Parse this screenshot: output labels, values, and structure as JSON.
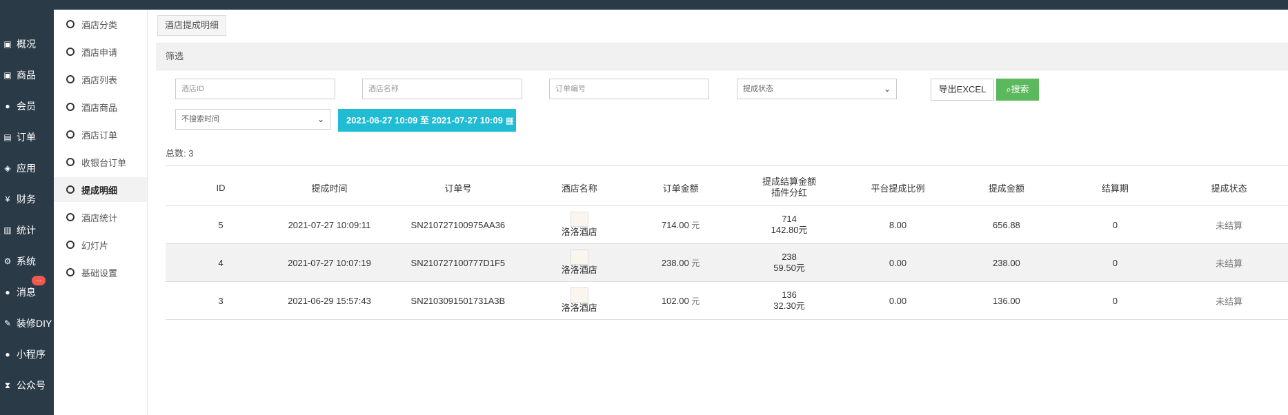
{
  "left_nav": [
    {
      "icon": "dashboard-icon",
      "label": "概况"
    },
    {
      "icon": "box-icon",
      "label": "商品"
    },
    {
      "icon": "users-icon",
      "label": "会员"
    },
    {
      "icon": "cart-icon",
      "label": "订单"
    },
    {
      "icon": "cubes-icon",
      "label": "应用"
    },
    {
      "icon": "yen-icon",
      "label": "财务"
    },
    {
      "icon": "bar-chart-icon",
      "label": "统计"
    },
    {
      "icon": "cogs-icon",
      "label": "系统"
    },
    {
      "icon": "chat-icon",
      "label": "消息"
    },
    {
      "icon": "wrench-icon",
      "label": "装修DIY"
    },
    {
      "icon": "wechat-icon",
      "label": "小程序"
    },
    {
      "icon": "hourglass-icon",
      "label": "公众号"
    }
  ],
  "badge": "...",
  "sub_nav": [
    {
      "label": "酒店分类"
    },
    {
      "label": "酒店申请"
    },
    {
      "label": "酒店列表"
    },
    {
      "label": "酒店商品"
    },
    {
      "label": "酒店订单"
    },
    {
      "label": "收银台订单"
    },
    {
      "label": "提成明细",
      "active": true
    },
    {
      "label": "酒店统计"
    },
    {
      "label": "幻灯片"
    },
    {
      "label": "基础设置"
    }
  ],
  "tab_label": "酒店提成明细",
  "filter": {
    "title": "筛选",
    "hotel_id_placeholder": "酒店ID",
    "hotel_name_placeholder": "酒店名称",
    "order_no_placeholder": "订单编号",
    "status_select": "提成状态",
    "time_select": "不搜索时间",
    "date_range": "2021-06-27 10:09 至 2021-07-27 10:09",
    "export_label": "导出EXCEL",
    "search_label": "搜索"
  },
  "total_label": "总数:",
  "total_value": "3",
  "table": {
    "headers": [
      "ID",
      "提成时间",
      "订单号",
      "酒店名称",
      "订单金额",
      "提成结算金额",
      "插件分红",
      "平台提成比例",
      "提成金额",
      "结算期",
      "提成状态"
    ],
    "rows": [
      {
        "id": "5",
        "time": "2021-07-27 10:09:11",
        "order": "SN210727100975AA36",
        "hotel": "洛洛酒店",
        "amount": "714.00",
        "unit": "元",
        "settle": "714",
        "plugin": "142.80元",
        "ratio": "8.00",
        "commission": "656.88",
        "period": "0",
        "status": "未结算"
      },
      {
        "id": "4",
        "time": "2021-07-27 10:07:19",
        "order": "SN210727100777D1F5",
        "hotel": "洛洛酒店",
        "amount": "238.00",
        "unit": "元",
        "settle": "238",
        "plugin": "59.50元",
        "ratio": "0.00",
        "commission": "238.00",
        "period": "0",
        "status": "未结算"
      },
      {
        "id": "3",
        "time": "2021-06-29 15:57:43",
        "order": "SN2103091501731A3B",
        "hotel": "洛洛酒店",
        "amount": "102.00",
        "unit": "元",
        "settle": "136",
        "plugin": "32.30元",
        "ratio": "0.00",
        "commission": "136.00",
        "period": "0",
        "status": "未结算"
      }
    ]
  },
  "colors": {
    "sidebar": "#2b3a47",
    "date_range": "#20bcd4",
    "search_button": "#5cb85c",
    "badge": "#ee5a4e"
  }
}
